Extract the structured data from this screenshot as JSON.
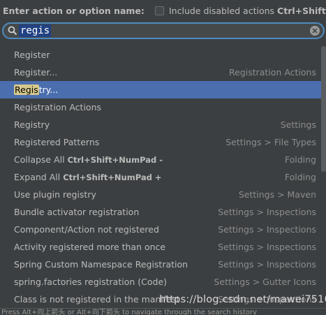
{
  "header": {
    "title": "Enter action or option name:",
    "checkbox_label": "Include disabled actions",
    "checkbox_shortcut": "Ctrl+Shift+A"
  },
  "search": {
    "value": "regis"
  },
  "items": [
    {
      "name": "Register",
      "group": ""
    },
    {
      "name": "Register...",
      "group": "Registration Actions"
    },
    {
      "name_prefix": "Regis",
      "name_rest": "try...",
      "group": ""
    },
    {
      "name": "Registration Actions",
      "group": ""
    },
    {
      "name": "Registry",
      "group": "Settings"
    },
    {
      "name": "Registered Patterns",
      "group": "Settings > File Types"
    },
    {
      "name": "Collapse All",
      "shortcut": "Ctrl+Shift+NumPad -",
      "group": "Folding"
    },
    {
      "name": "Expand All",
      "shortcut": "Ctrl+Shift+NumPad +",
      "group": "Folding"
    },
    {
      "name": "Use plugin registry",
      "group": "Settings > Maven"
    },
    {
      "name": "Bundle activator registration",
      "group": "Settings > Inspections"
    },
    {
      "name": "Component/Action not registered",
      "group": "Settings > Inspections"
    },
    {
      "name": "Activity registered more than once",
      "group": "Settings > Inspections"
    },
    {
      "name": "Spring Custom Namespace Registration",
      "group": "Settings > Inspections"
    },
    {
      "name": "spring.factories registration (Code)",
      "group": "Settings > Gutter Icons"
    },
    {
      "name": "Class is not registered in the manifest",
      "group": "Settings > Inspections"
    }
  ],
  "watermark": "https://blog.csdn.net/mawei7510",
  "footer": "Press Alt+向上箭头 or Alt+向下箭头 to navigate through the search history",
  "colors": {
    "background": "#3c3f41",
    "selection": "#4b6eaf",
    "search_border": "#4e8bc2",
    "match_highlight": "#d6c88d"
  }
}
